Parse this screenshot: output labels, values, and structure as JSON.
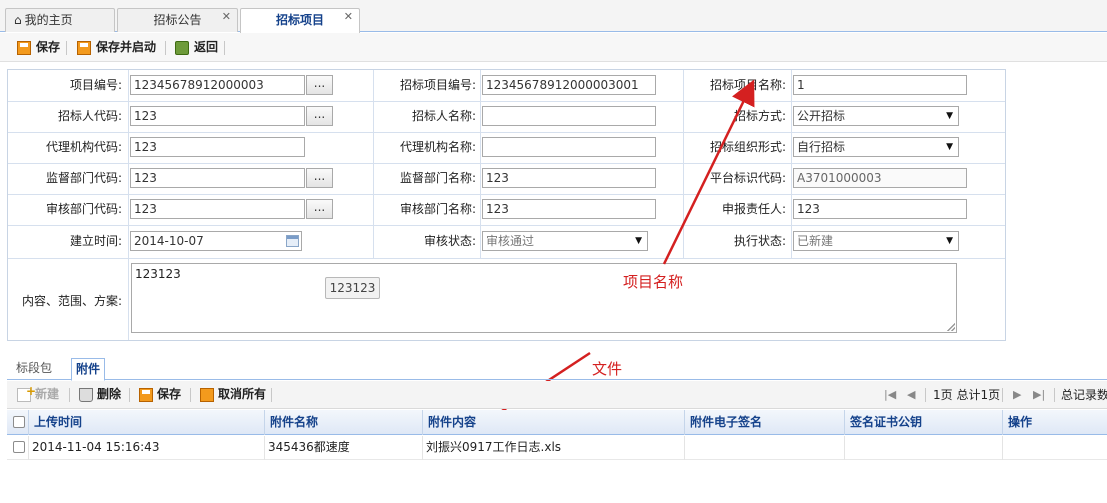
{
  "tabs": [
    {
      "label": "我的主页",
      "closable": false
    },
    {
      "label": "招标公告",
      "closable": true
    },
    {
      "label": "招标项目",
      "closable": true,
      "active": true
    }
  ],
  "toolbar": {
    "save": "保存",
    "save_start": "保存并启动",
    "back": "返回"
  },
  "form": {
    "project_code_label": "项目编号:",
    "project_code": "12345678912000003",
    "tender_project_code_label": "招标项目编号:",
    "tender_project_code": "12345678912000003001",
    "tender_project_name_label": "招标项目名称:",
    "tender_project_name": "1",
    "tenderer_code_label": "招标人代码:",
    "tenderer_code": "123",
    "tenderer_name_label": "招标人名称:",
    "tenderer_name": "",
    "tender_method_label": "招标方式:",
    "tender_method": "公开招标",
    "agency_code_label": "代理机构代码:",
    "agency_code": "123",
    "agency_name_label": "代理机构名称:",
    "agency_name": "",
    "tender_org_form_label": "招标组织形式:",
    "tender_org_form": "自行招标",
    "supervisor_code_label": "监督部门代码:",
    "supervisor_code": "123",
    "supervisor_name_label": "监督部门名称:",
    "supervisor_name": "123",
    "platform_code_label": "平台标识代码:",
    "platform_code": "A3701000003",
    "audit_dept_code_label": "审核部门代码:",
    "audit_dept_code": "123",
    "audit_dept_name_label": "审核部门名称:",
    "audit_dept_name": "123",
    "reporter_label": "申报责任人:",
    "reporter": "123",
    "created_label": "建立时间:",
    "created": "2014-10-07",
    "audit_status_label": "审核状态:",
    "audit_status": "审核通过",
    "exec_status_label": "执行状态:",
    "exec_status": "已新建",
    "content_label": "内容、范围、方案:",
    "content": "123123",
    "tooltip": "123123",
    "ellipsis": "..."
  },
  "annotations": {
    "project_name": "项目名称",
    "file": "文件"
  },
  "subtabs": [
    "标段包",
    "附件"
  ],
  "grid_toolbar": {
    "new": "新建",
    "delete": "删除",
    "save": "保存",
    "cancel_all": "取消所有",
    "page_info": "1页 总计1页",
    "total": "总记录数"
  },
  "grid": {
    "columns": [
      "上传时间",
      "附件名称",
      "附件内容",
      "附件电子签名",
      "签名证书公钥",
      "操作"
    ],
    "rows": [
      [
        "2014-11-04 15:16:43",
        "345436都速度",
        "刘振兴0917工作日志.xls",
        "",
        "",
        ""
      ]
    ]
  },
  "colors": {
    "annotation_red": "#d42020",
    "header_blue": "#15428b"
  }
}
